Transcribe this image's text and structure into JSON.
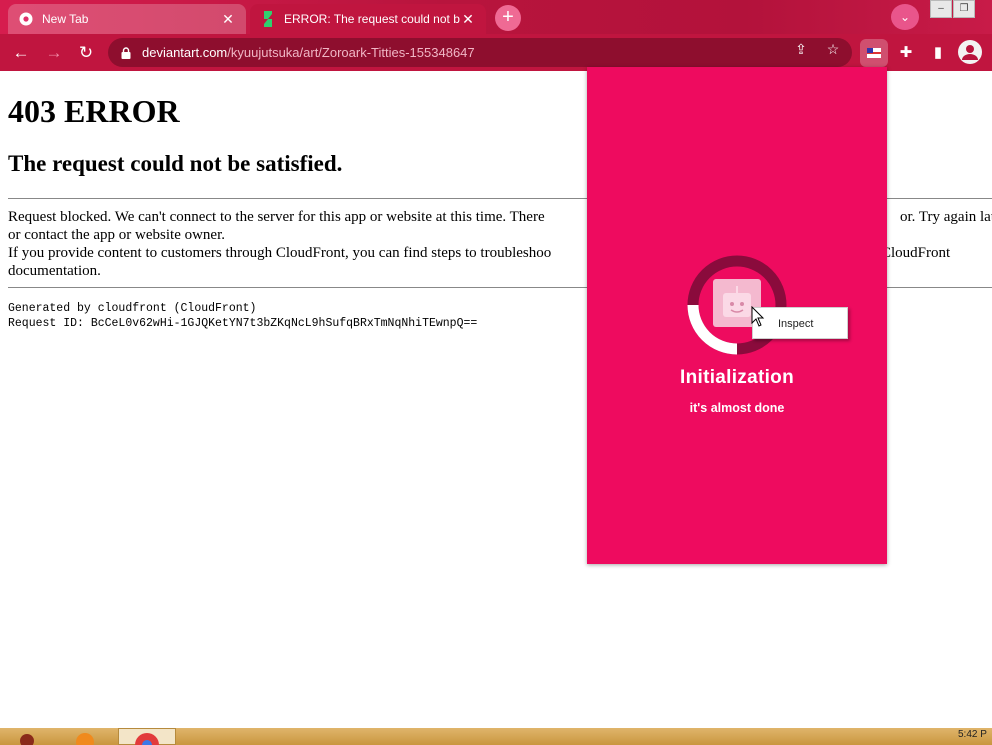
{
  "browser": {
    "tabs": [
      {
        "label": "New Tab",
        "icon": "chrome-icon"
      },
      {
        "label": "ERROR: The request could not be",
        "icon": "deviantart-icon"
      }
    ],
    "address": {
      "host": "deviantart.com",
      "path": "/kyuujutsuka/art/Zoroark-Titties-155348647"
    }
  },
  "page": {
    "heading": "403 ERROR",
    "subheading": "The request could not be satisfied.",
    "para1_line1_a": "Request blocked. We can't connect to the server for this app or website at this time. There",
    "para1_line1_b": "or. Try again late",
    "para1_line2": "or contact the app or website owner.",
    "para2_line1_a": "If you provide content to customers through CloudFront, you can find steps to troubleshoo",
    "para2_line1_b": "CloudFront",
    "para2_line2": "documentation.",
    "generated_by": "Generated by cloudfront (CloudFront)",
    "request_id": "Request ID: BcCeL0v62wHi-1GJQKetYN7t3bZKqNcL9hSufqBRxTmNqNhiTEwnpQ=="
  },
  "popup": {
    "title": "Initialization",
    "subtitle": "it's almost done",
    "background_color": "#ee0b5f"
  },
  "context_menu": {
    "item": "Inspect"
  },
  "taskbar": {
    "clock": "5:42 P"
  },
  "colors": {
    "chrome_accent": "#c0153f",
    "omnibox": "#8e0e2e"
  }
}
